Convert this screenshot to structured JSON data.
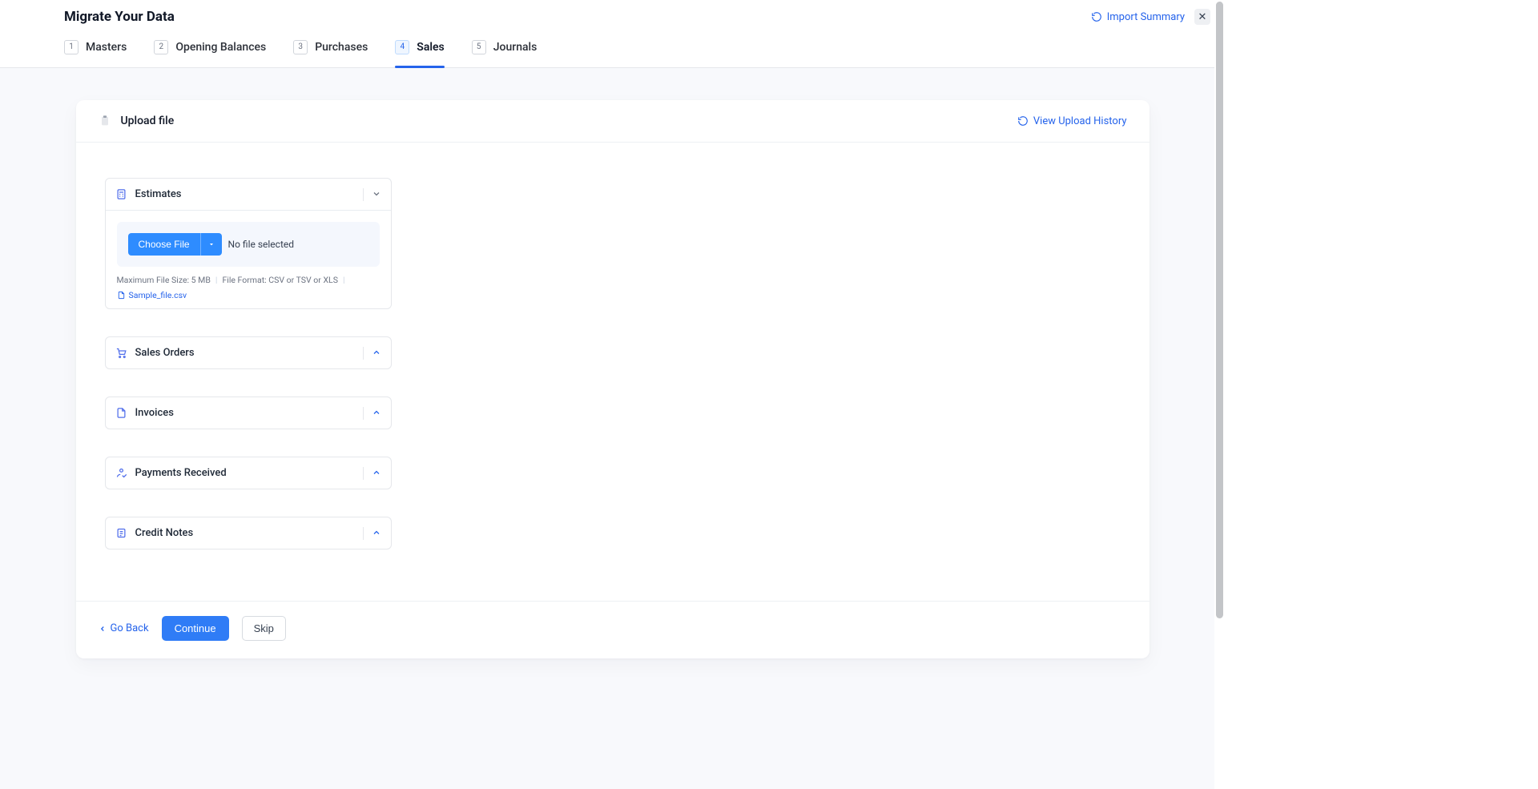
{
  "header": {
    "title": "Migrate Your Data",
    "import_summary_label": "Import Summary"
  },
  "tabs": [
    {
      "num": "1",
      "label": "Masters"
    },
    {
      "num": "2",
      "label": "Opening Balances"
    },
    {
      "num": "3",
      "label": "Purchases"
    },
    {
      "num": "4",
      "label": "Sales"
    },
    {
      "num": "5",
      "label": "Journals"
    }
  ],
  "active_tab_index": 3,
  "panel": {
    "upload_title": "Upload file",
    "view_history_label": "View Upload History"
  },
  "sections": [
    {
      "title": "Estimates",
      "icon": "calc",
      "expanded": true
    },
    {
      "title": "Sales Orders",
      "icon": "cart",
      "expanded": false
    },
    {
      "title": "Invoices",
      "icon": "file",
      "expanded": false
    },
    {
      "title": "Payments Received",
      "icon": "hand",
      "expanded": false
    },
    {
      "title": "Credit Notes",
      "icon": "note",
      "expanded": false
    }
  ],
  "upload": {
    "choose_label": "Choose File",
    "no_file_label": "No file selected",
    "max_size_label": "Maximum File Size: 5 MB",
    "format_label": "File Format: CSV or TSV or XLS",
    "sample_label": "Sample_file.csv"
  },
  "footer": {
    "go_back_label": "Go Back",
    "continue_label": "Continue",
    "skip_label": "Skip"
  }
}
